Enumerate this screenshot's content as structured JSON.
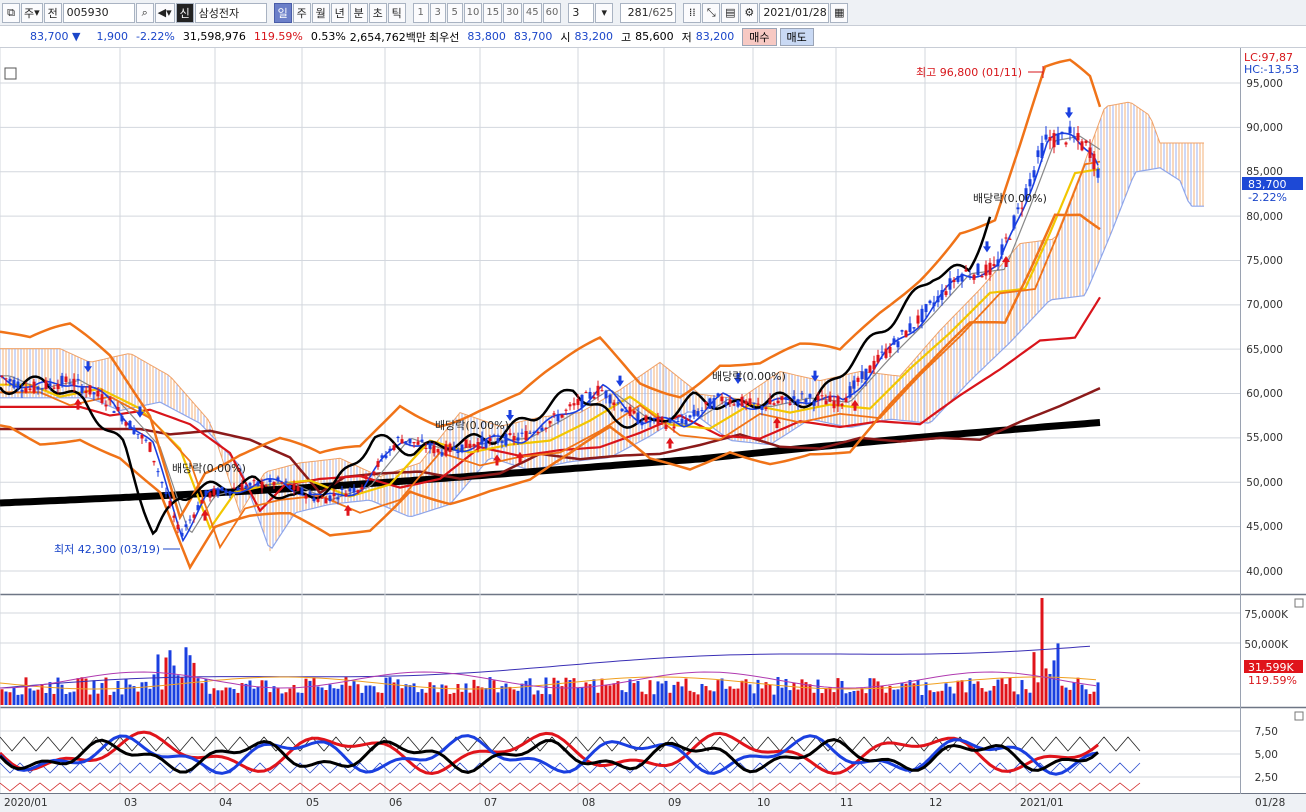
{
  "toolbar": {
    "period_type": "주",
    "view_mode": "전",
    "stock_code": "005930",
    "stock_badge": "신",
    "stock_name": "삼성전자",
    "periods": [
      "일",
      "주",
      "월",
      "년",
      "분",
      "초",
      "틱"
    ],
    "selected_period": "일",
    "intervals": [
      "1",
      "3",
      "5",
      "10",
      "15",
      "30",
      "45",
      "60"
    ],
    "interval_input": "3",
    "count": "281",
    "count_total": "/625",
    "date": "2021/01/28"
  },
  "quote": {
    "price": "83,700",
    "change": "1,900",
    "change_pct": "-2.22%",
    "volume": "31,598,976",
    "volume_ratio": "119.59%",
    "turnover_pct": "0.53%",
    "amount": "2,654,762백만",
    "best_ask_label": "최우선",
    "best_ask": "83,800",
    "best_bid": "83,700",
    "open_label": "시",
    "open": "83,200",
    "high_label": "고",
    "high": "85,600",
    "low_label": "저",
    "low": "83,200",
    "buy_label": "매수",
    "sell_label": "매도"
  },
  "price_panel": {
    "lc_label": "LC:97,87",
    "hc_label": "HC:-13,53",
    "current_price_tag": "83,700",
    "current_change_tag": "-2.22%",
    "high_annotation": "최고 96,800 (01/11)",
    "low_annotation": "최저 42,300 (03/19)",
    "dividend_labels": [
      "배당락(0.00%)",
      "배당락(0.00%)",
      "배당락(0.00%)",
      "배당락(0.00%)"
    ],
    "y_ticks": [
      "95,000",
      "90,000",
      "85,000",
      "80,000",
      "75,000",
      "70,000",
      "65,000",
      "60,000",
      "55,000",
      "50,000",
      "45,000",
      "40,000"
    ]
  },
  "volume_panel": {
    "y_ticks": [
      "75,000K",
      "50,000K"
    ],
    "current_volume_tag": "31,599K",
    "current_ratio_tag": "119.59%"
  },
  "oscillator_panel": {
    "y_ticks": [
      "7,50",
      "5,00",
      "2,50"
    ]
  },
  "x_axis": {
    "labels": [
      "2020/01",
      "03",
      "04",
      "05",
      "06",
      "07",
      "08",
      "09",
      "10",
      "11",
      "12",
      "2021/01"
    ],
    "end_date": "01/28"
  },
  "colors": {
    "up": "#e0141b",
    "down": "#1a3fe0",
    "accent_orange": "#f07318",
    "ma_yellow": "#f2c600",
    "ma_maroon": "#8b1a1a",
    "ma_thick": "#000000",
    "cloud": "#f3b07a",
    "grid": "#d3d7de"
  }
}
